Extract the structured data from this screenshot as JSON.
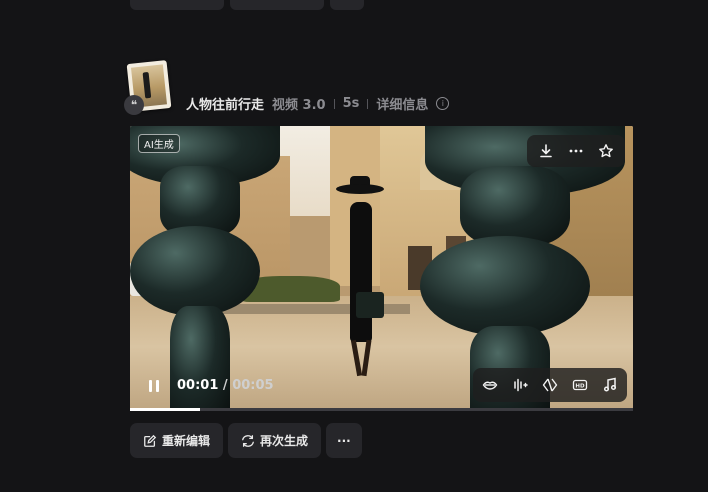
{
  "record": {
    "prompt": "人物往前行走",
    "model": "视频 3.0",
    "duration": "5s",
    "details_label": "详细信息"
  },
  "video": {
    "ai_badge": "AI生成",
    "current_time": "00:01",
    "total_time": "/ 00:05",
    "progress": 0.14,
    "top_tools": [
      "download-icon",
      "more-icon",
      "star-icon"
    ],
    "bottom_tools": [
      "lip-sync-icon",
      "audio-edit-icon",
      "frame-interpolate-icon",
      "hd-icon",
      "music-icon"
    ]
  },
  "actions": {
    "reedit_label": "重新编辑",
    "regenerate_label": "再次生成",
    "more_label": "···"
  }
}
